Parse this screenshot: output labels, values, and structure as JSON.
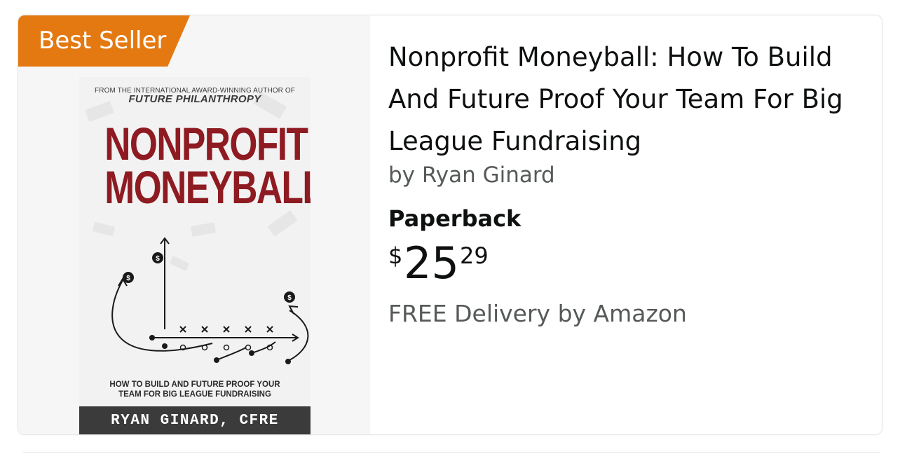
{
  "badge": {
    "label": "Best Seller",
    "color": "#e47911"
  },
  "cover": {
    "top_line": "FROM THE INTERNATIONAL AWARD-WINNING AUTHOR OF",
    "top_book": "FUTURE PHILANTHROPY",
    "title_line1": "NONPROFIT",
    "title_line2": "MONEYBALL",
    "subtitle_line1": "HOW TO BUILD AND FUTURE PROOF YOUR",
    "subtitle_line2": "TEAM FOR BIG LEAGUE FUNDRAISING",
    "author": "RYAN GINARD, CFRE",
    "title_color": "#8e1b22"
  },
  "product": {
    "title": "Nonprofit Moneyball: How To Build And Future Proof Your Team For Big League Fundraising",
    "byline": "by Ryan Ginard",
    "format": "Paperback",
    "price": {
      "symbol": "$",
      "whole": "25",
      "fraction": "29"
    },
    "delivery": "FREE Delivery by Amazon"
  }
}
